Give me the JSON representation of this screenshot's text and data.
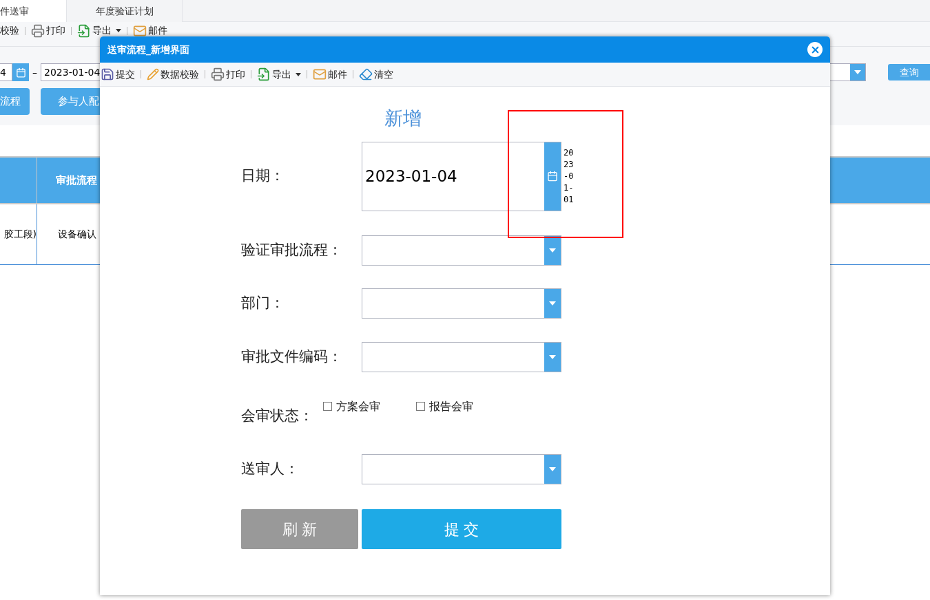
{
  "background": {
    "tabs": [
      {
        "label": "件送审",
        "selected": true
      },
      {
        "label": "年度验证计划",
        "selected": false
      }
    ],
    "toolbar": [
      {
        "kind": "text",
        "label": "校验"
      },
      {
        "kind": "print",
        "label": "打印"
      },
      {
        "kind": "export",
        "label": "导出"
      },
      {
        "kind": "mail",
        "label": "邮件"
      }
    ],
    "filter": {
      "date_from": "4",
      "separator": "–",
      "date_to": "2023-01-04",
      "query_button": "查询"
    },
    "buttons": [
      "流程",
      "参与人配"
    ],
    "table": {
      "columns": [
        "",
        "审批流程"
      ],
      "rows": [
        [
          "胶工段)",
          "设备确认"
        ]
      ]
    }
  },
  "dialog": {
    "title": "送审流程_新增界面",
    "toolbar": [
      {
        "kind": "save",
        "label": "提交"
      },
      {
        "kind": "check",
        "label": "数据校验"
      },
      {
        "kind": "print",
        "label": "打印"
      },
      {
        "kind": "export",
        "label": "导出"
      },
      {
        "kind": "mail",
        "label": "邮件"
      },
      {
        "kind": "clear",
        "label": "清空"
      }
    ],
    "heading": "新增",
    "fields": [
      {
        "kind": "date",
        "label": "日期：",
        "value": "2023-01-04",
        "popup": "2023-01-01",
        "highlighted": true
      },
      {
        "kind": "select",
        "label": "验证审批流程："
      },
      {
        "kind": "select",
        "label": "部门："
      },
      {
        "kind": "select",
        "label": "审批文件编码："
      },
      {
        "kind": "checks",
        "label": "会审状态：",
        "options": [
          {
            "label": "方案会审",
            "checked": false
          },
          {
            "label": "报告会审",
            "checked": false
          }
        ]
      },
      {
        "kind": "select",
        "label": "送审人："
      }
    ],
    "buttons": [
      {
        "kind": "refresh",
        "label": "刷 新"
      },
      {
        "kind": "submit",
        "label": "提 交"
      }
    ]
  }
}
